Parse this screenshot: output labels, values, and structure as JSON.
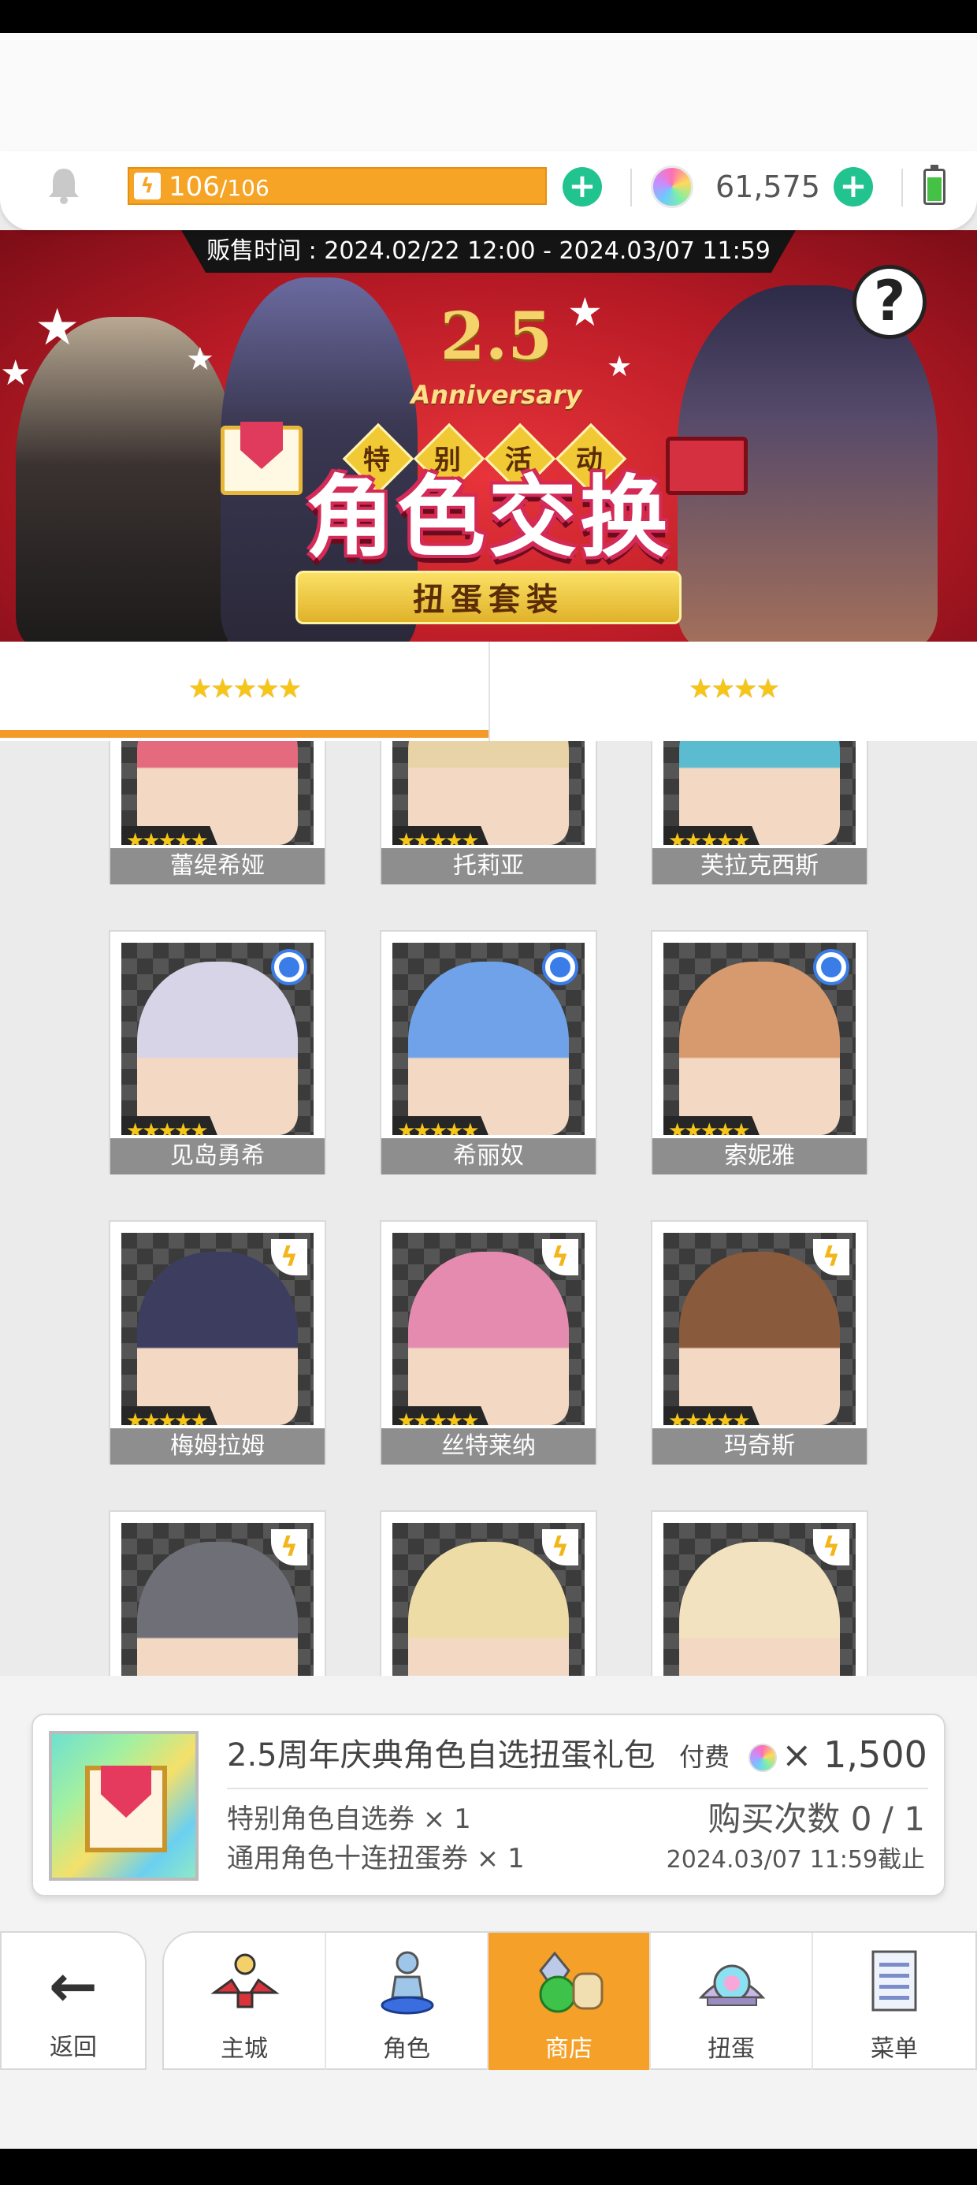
{
  "resources": {
    "energy_current": "106",
    "energy_max": "/106",
    "gem_count": "61,575"
  },
  "banner": {
    "sale_time": "贩售时间 : 2024.02/22 12:00 - 2024.03/07 11:59",
    "anniv_number": "2.5",
    "anniv_text": "Anniversary",
    "event_chars": [
      "特",
      "别",
      "活",
      "动"
    ],
    "title": "角色交换",
    "subtitle": "扭蛋套装",
    "help": "?"
  },
  "tabs": [
    {
      "id": "5star",
      "stars": "★★★★★",
      "active": true
    },
    {
      "id": "4star",
      "stars": "★★★★",
      "active": false
    }
  ],
  "characters": [
    {
      "name": "蕾缇希娅",
      "stars": "★★★★★",
      "badge": "none",
      "art": "#e46a7e"
    },
    {
      "name": "托莉亚",
      "stars": "★★★★★",
      "badge": "none",
      "art": "#e8d3a6"
    },
    {
      "name": "芙拉克西斯",
      "stars": "★★★★★",
      "badge": "none",
      "art": "#5bbcd0"
    },
    {
      "name": "见岛勇希",
      "stars": "★★★★★",
      "badge": "blue",
      "art": "#d8d4e8"
    },
    {
      "name": "希丽奴",
      "stars": "★★★★★",
      "badge": "blue",
      "art": "#6fa2e8"
    },
    {
      "name": "索妮雅",
      "stars": "★★★★★",
      "badge": "blue",
      "art": "#d69a6e"
    },
    {
      "name": "梅姆拉姆",
      "stars": "★★★★★",
      "badge": "bolt",
      "art": "#3d3d60"
    },
    {
      "name": "丝特莱纳",
      "stars": "★★★★★",
      "badge": "bolt",
      "art": "#e68bb0"
    },
    {
      "name": "玛奇斯",
      "stars": "★★★★★",
      "badge": "bolt",
      "art": "#8a5a3c"
    },
    {
      "name": "",
      "stars": "★★★★★",
      "badge": "bolt",
      "art": "#6f6f78"
    },
    {
      "name": "",
      "stars": "★★★★★",
      "badge": "bolt",
      "art": "#eedca6"
    },
    {
      "name": "",
      "stars": "★★★★★",
      "badge": "bolt",
      "art": "#f2e2c0"
    }
  ],
  "package": {
    "title": "2.5周年庆典角色自选扭蛋礼包",
    "paid_label": "付费",
    "price": "× 1,500",
    "item1": "特别角色自选券 × 1",
    "item2": "通用角色十连扭蛋券 × 1",
    "buy_count": "购买次数 0 / 1",
    "deadline": "2024.03/07 11:59截止"
  },
  "nav": {
    "back": "返回",
    "items": [
      {
        "label": "主城",
        "active": false,
        "icon": "castle-icon"
      },
      {
        "label": "角色",
        "active": false,
        "icon": "character-icon"
      },
      {
        "label": "商店",
        "active": true,
        "icon": "shop-icon"
      },
      {
        "label": "扭蛋",
        "active": false,
        "icon": "gacha-icon"
      },
      {
        "label": "菜单",
        "active": false,
        "icon": "menu-icon"
      }
    ]
  },
  "colors": {
    "accent": "#f5a028",
    "plus_green": "#21c38e",
    "banner_red": "#b71a25"
  }
}
